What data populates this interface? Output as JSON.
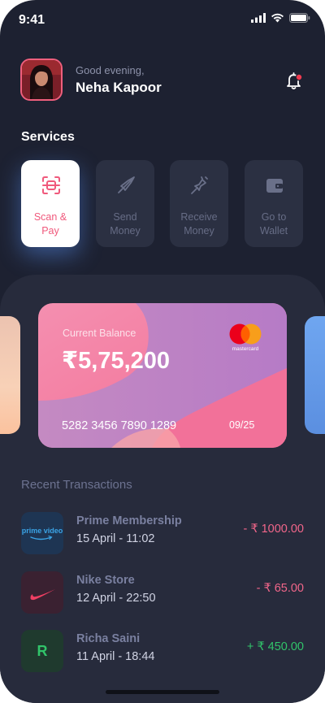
{
  "status_bar": {
    "time": "9:41",
    "icons": [
      "signal-icon",
      "wifi-icon",
      "battery-icon"
    ]
  },
  "header": {
    "greeting": "Good evening,",
    "user_name": "Neha Kapoor",
    "notification_icon": "bell-icon",
    "has_unread": true
  },
  "services": {
    "title": "Services",
    "items": [
      {
        "label": "Scan & Pay",
        "icon": "scan-icon",
        "active": true
      },
      {
        "label": "Send Money",
        "icon": "send-icon",
        "active": false
      },
      {
        "label": "Receive Money",
        "icon": "receive-icon",
        "active": false
      },
      {
        "label": "Go to Wallet",
        "icon": "wallet-icon",
        "active": false
      }
    ]
  },
  "card": {
    "balance_label": "Current Balance",
    "balance": "₹5,75,200",
    "number": "5282 3456 7890 1289",
    "expiry": "09/25",
    "brand": "mastercard"
  },
  "transactions": {
    "title": "Recent Transactions",
    "items": [
      {
        "name": "Prime Membership",
        "date": "15 April  - 11:02",
        "amount": "- ₹ 1000.00",
        "type": "debit",
        "logo_text": "prime video",
        "logo_bg": "#1e3553"
      },
      {
        "name": "Nike Store",
        "date": "12 April  - 22:50",
        "amount": "- ₹ 65.00",
        "type": "debit",
        "logo_text": "",
        "logo_bg": "#3a2131"
      },
      {
        "name": "Richa Saini",
        "date": "11 April  - 18:44",
        "amount": "+ ₹ 450.00",
        "type": "credit",
        "logo_text": "R",
        "logo_bg": "#1f3a2e"
      }
    ]
  },
  "colors": {
    "background": "#1d2131",
    "panel": "#272b3c",
    "accent_pink": "#f0597c",
    "credit_green": "#31c46a"
  }
}
